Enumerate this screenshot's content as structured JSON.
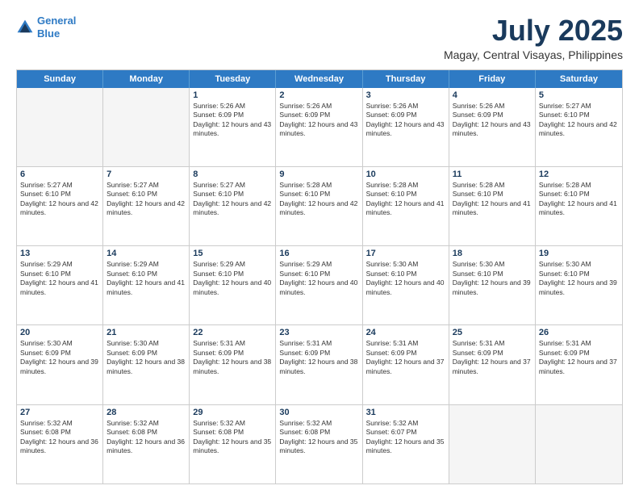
{
  "logo": {
    "line1": "General",
    "line2": "Blue"
  },
  "title": "July 2025",
  "subtitle": "Magay, Central Visayas, Philippines",
  "header_days": [
    "Sunday",
    "Monday",
    "Tuesday",
    "Wednesday",
    "Thursday",
    "Friday",
    "Saturday"
  ],
  "rows": [
    [
      {
        "day": "",
        "empty": true
      },
      {
        "day": "",
        "empty": true
      },
      {
        "day": "1",
        "sunrise": "Sunrise: 5:26 AM",
        "sunset": "Sunset: 6:09 PM",
        "daylight": "Daylight: 12 hours and 43 minutes."
      },
      {
        "day": "2",
        "sunrise": "Sunrise: 5:26 AM",
        "sunset": "Sunset: 6:09 PM",
        "daylight": "Daylight: 12 hours and 43 minutes."
      },
      {
        "day": "3",
        "sunrise": "Sunrise: 5:26 AM",
        "sunset": "Sunset: 6:09 PM",
        "daylight": "Daylight: 12 hours and 43 minutes."
      },
      {
        "day": "4",
        "sunrise": "Sunrise: 5:26 AM",
        "sunset": "Sunset: 6:09 PM",
        "daylight": "Daylight: 12 hours and 43 minutes."
      },
      {
        "day": "5",
        "sunrise": "Sunrise: 5:27 AM",
        "sunset": "Sunset: 6:10 PM",
        "daylight": "Daylight: 12 hours and 42 minutes."
      }
    ],
    [
      {
        "day": "6",
        "sunrise": "Sunrise: 5:27 AM",
        "sunset": "Sunset: 6:10 PM",
        "daylight": "Daylight: 12 hours and 42 minutes."
      },
      {
        "day": "7",
        "sunrise": "Sunrise: 5:27 AM",
        "sunset": "Sunset: 6:10 PM",
        "daylight": "Daylight: 12 hours and 42 minutes."
      },
      {
        "day": "8",
        "sunrise": "Sunrise: 5:27 AM",
        "sunset": "Sunset: 6:10 PM",
        "daylight": "Daylight: 12 hours and 42 minutes."
      },
      {
        "day": "9",
        "sunrise": "Sunrise: 5:28 AM",
        "sunset": "Sunset: 6:10 PM",
        "daylight": "Daylight: 12 hours and 42 minutes."
      },
      {
        "day": "10",
        "sunrise": "Sunrise: 5:28 AM",
        "sunset": "Sunset: 6:10 PM",
        "daylight": "Daylight: 12 hours and 41 minutes."
      },
      {
        "day": "11",
        "sunrise": "Sunrise: 5:28 AM",
        "sunset": "Sunset: 6:10 PM",
        "daylight": "Daylight: 12 hours and 41 minutes."
      },
      {
        "day": "12",
        "sunrise": "Sunrise: 5:28 AM",
        "sunset": "Sunset: 6:10 PM",
        "daylight": "Daylight: 12 hours and 41 minutes."
      }
    ],
    [
      {
        "day": "13",
        "sunrise": "Sunrise: 5:29 AM",
        "sunset": "Sunset: 6:10 PM",
        "daylight": "Daylight: 12 hours and 41 minutes."
      },
      {
        "day": "14",
        "sunrise": "Sunrise: 5:29 AM",
        "sunset": "Sunset: 6:10 PM",
        "daylight": "Daylight: 12 hours and 41 minutes."
      },
      {
        "day": "15",
        "sunrise": "Sunrise: 5:29 AM",
        "sunset": "Sunset: 6:10 PM",
        "daylight": "Daylight: 12 hours and 40 minutes."
      },
      {
        "day": "16",
        "sunrise": "Sunrise: 5:29 AM",
        "sunset": "Sunset: 6:10 PM",
        "daylight": "Daylight: 12 hours and 40 minutes."
      },
      {
        "day": "17",
        "sunrise": "Sunrise: 5:30 AM",
        "sunset": "Sunset: 6:10 PM",
        "daylight": "Daylight: 12 hours and 40 minutes."
      },
      {
        "day": "18",
        "sunrise": "Sunrise: 5:30 AM",
        "sunset": "Sunset: 6:10 PM",
        "daylight": "Daylight: 12 hours and 39 minutes."
      },
      {
        "day": "19",
        "sunrise": "Sunrise: 5:30 AM",
        "sunset": "Sunset: 6:10 PM",
        "daylight": "Daylight: 12 hours and 39 minutes."
      }
    ],
    [
      {
        "day": "20",
        "sunrise": "Sunrise: 5:30 AM",
        "sunset": "Sunset: 6:09 PM",
        "daylight": "Daylight: 12 hours and 39 minutes."
      },
      {
        "day": "21",
        "sunrise": "Sunrise: 5:30 AM",
        "sunset": "Sunset: 6:09 PM",
        "daylight": "Daylight: 12 hours and 38 minutes."
      },
      {
        "day": "22",
        "sunrise": "Sunrise: 5:31 AM",
        "sunset": "Sunset: 6:09 PM",
        "daylight": "Daylight: 12 hours and 38 minutes."
      },
      {
        "day": "23",
        "sunrise": "Sunrise: 5:31 AM",
        "sunset": "Sunset: 6:09 PM",
        "daylight": "Daylight: 12 hours and 38 minutes."
      },
      {
        "day": "24",
        "sunrise": "Sunrise: 5:31 AM",
        "sunset": "Sunset: 6:09 PM",
        "daylight": "Daylight: 12 hours and 37 minutes."
      },
      {
        "day": "25",
        "sunrise": "Sunrise: 5:31 AM",
        "sunset": "Sunset: 6:09 PM",
        "daylight": "Daylight: 12 hours and 37 minutes."
      },
      {
        "day": "26",
        "sunrise": "Sunrise: 5:31 AM",
        "sunset": "Sunset: 6:09 PM",
        "daylight": "Daylight: 12 hours and 37 minutes."
      }
    ],
    [
      {
        "day": "27",
        "sunrise": "Sunrise: 5:32 AM",
        "sunset": "Sunset: 6:08 PM",
        "daylight": "Daylight: 12 hours and 36 minutes."
      },
      {
        "day": "28",
        "sunrise": "Sunrise: 5:32 AM",
        "sunset": "Sunset: 6:08 PM",
        "daylight": "Daylight: 12 hours and 36 minutes."
      },
      {
        "day": "29",
        "sunrise": "Sunrise: 5:32 AM",
        "sunset": "Sunset: 6:08 PM",
        "daylight": "Daylight: 12 hours and 35 minutes."
      },
      {
        "day": "30",
        "sunrise": "Sunrise: 5:32 AM",
        "sunset": "Sunset: 6:08 PM",
        "daylight": "Daylight: 12 hours and 35 minutes."
      },
      {
        "day": "31",
        "sunrise": "Sunrise: 5:32 AM",
        "sunset": "Sunset: 6:07 PM",
        "daylight": "Daylight: 12 hours and 35 minutes."
      },
      {
        "day": "",
        "empty": true
      },
      {
        "day": "",
        "empty": true
      }
    ]
  ]
}
